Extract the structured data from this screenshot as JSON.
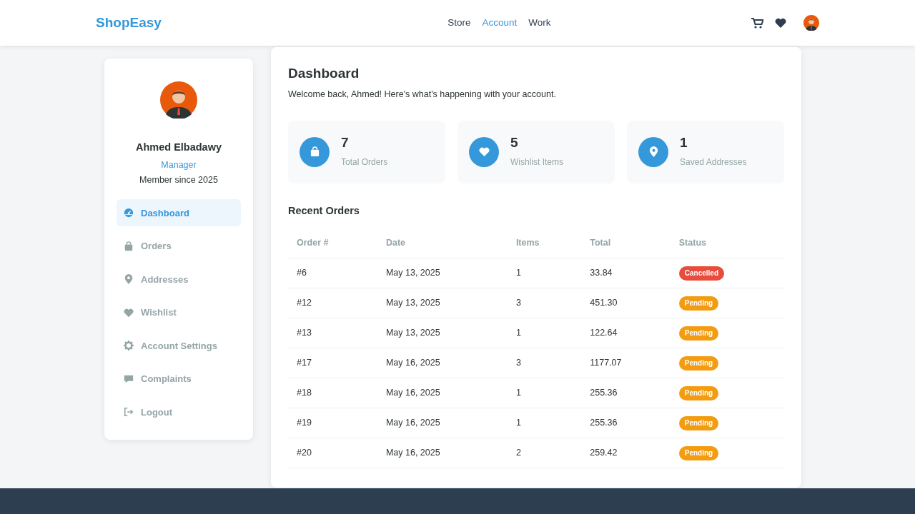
{
  "navbar": {
    "brand": "ShopEasy",
    "links": [
      {
        "label": "Store",
        "selected": false
      },
      {
        "label": "Account",
        "selected": true
      },
      {
        "label": "Work",
        "selected": false
      }
    ]
  },
  "profile": {
    "name": "Ahmed Elbadawy",
    "role": "Manager",
    "member_since": "Member since 2025"
  },
  "sidebar": {
    "items": [
      {
        "label": "Dashboard",
        "selected": true
      },
      {
        "label": "Orders",
        "selected": false
      },
      {
        "label": "Addresses",
        "selected": false
      },
      {
        "label": "Wishlist",
        "selected": false
      },
      {
        "label": "Account Settings",
        "selected": false
      },
      {
        "label": "Complaints",
        "selected": false
      },
      {
        "label": "Logout",
        "selected": false
      }
    ]
  },
  "dashboard": {
    "title": "Dashboard",
    "subtitle": "Welcome back, Ahmed! Here's what's happening with your account.",
    "stats": [
      {
        "value": "7",
        "label": "Total Orders"
      },
      {
        "value": "5",
        "label": "Wishlist Items"
      },
      {
        "value": "1",
        "label": "Saved Addresses"
      }
    ]
  },
  "recent_orders": {
    "title": "Recent Orders",
    "columns": [
      "Order #",
      "Date",
      "Items",
      "Total",
      "Status"
    ],
    "rows": [
      {
        "order": "#6",
        "date": "May 13, 2025",
        "items": "1",
        "total": "33.84",
        "status": "Cancelled",
        "kind": "cancelled"
      },
      {
        "order": "#12",
        "date": "May 13, 2025",
        "items": "3",
        "total": "451.30",
        "status": "Pending",
        "kind": "pending"
      },
      {
        "order": "#13",
        "date": "May 13, 2025",
        "items": "1",
        "total": "122.64",
        "status": "Pending",
        "kind": "pending"
      },
      {
        "order": "#17",
        "date": "May 16, 2025",
        "items": "3",
        "total": "1177.07",
        "status": "Pending",
        "kind": "pending"
      },
      {
        "order": "#18",
        "date": "May 16, 2025",
        "items": "1",
        "total": "255.36",
        "status": "Pending",
        "kind": "pending"
      },
      {
        "order": "#19",
        "date": "May 16, 2025",
        "items": "1",
        "total": "255.36",
        "status": "Pending",
        "kind": "pending"
      },
      {
        "order": "#20",
        "date": "May 16, 2025",
        "items": "2",
        "total": "259.42",
        "status": "Pending",
        "kind": "pending"
      }
    ]
  }
}
